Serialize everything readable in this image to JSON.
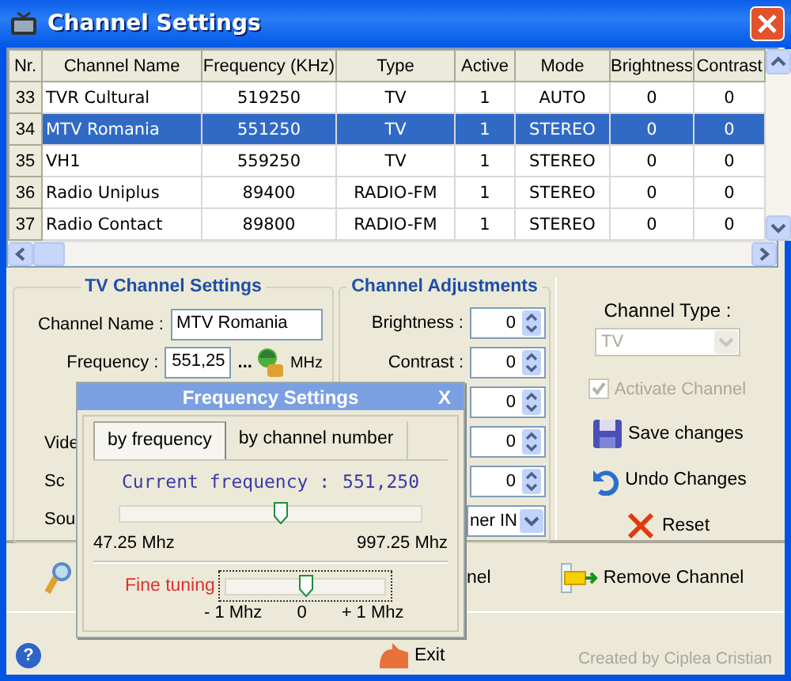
{
  "window": {
    "title": "Channel Settings"
  },
  "table": {
    "columns": [
      "Nr.",
      "Channel Name",
      "Frequency (KHz)",
      "Type",
      "Active",
      "Mode",
      "Brightness",
      "Contrast"
    ],
    "rows": [
      {
        "selected": false,
        "cells": [
          "33",
          "TVR Cultural",
          "519250",
          "TV",
          "1",
          "AUTO",
          "0",
          "0"
        ]
      },
      {
        "selected": true,
        "cells": [
          "34",
          "MTV Romania",
          "551250",
          "TV",
          "1",
          "STEREO",
          "0",
          "0"
        ]
      },
      {
        "selected": false,
        "cells": [
          "35",
          "VH1",
          "559250",
          "TV",
          "1",
          "STEREO",
          "0",
          "0"
        ]
      },
      {
        "selected": false,
        "cells": [
          "36",
          "Radio Uniplus",
          "89400",
          "RADIO-FM",
          "1",
          "STEREO",
          "0",
          "0"
        ]
      },
      {
        "selected": false,
        "cells": [
          "37",
          "Radio Contact",
          "89800",
          "RADIO-FM",
          "1",
          "STEREO",
          "0",
          "0"
        ]
      }
    ]
  },
  "tv_channel_settings": {
    "title": "TV Channel Settings",
    "name_label": "Channel Name :",
    "name_value": "MTV Romania",
    "frequency_label": "Frequency :",
    "frequency_value": "551,25",
    "more": "...",
    "unit": "MHz",
    "covered_labels": [
      "Vide",
      "Sc",
      "Sou"
    ]
  },
  "channel_adjustments": {
    "title": "Channel Adjustments",
    "rows": [
      {
        "kind": "spin",
        "label": "Brightness :",
        "value": "0"
      },
      {
        "kind": "spin",
        "label": "Contrast :",
        "value": "0"
      },
      {
        "kind": "spin",
        "value": "0"
      },
      {
        "kind": "spin",
        "value": "0"
      },
      {
        "kind": "spin",
        "value": "0"
      },
      {
        "kind": "dropdown",
        "value": "ner IN"
      }
    ]
  },
  "channel_panel": {
    "type_label": "Channel Type :",
    "type_value": "TV",
    "type_disabled": true,
    "activate_label": "Activate Channel",
    "activate_checked": true,
    "activate_disabled": true,
    "buttons": [
      {
        "kind": "save",
        "label": "Save changes"
      },
      {
        "kind": "undo",
        "label": "Undo Changes"
      },
      {
        "kind": "reset",
        "label": "Reset"
      }
    ]
  },
  "bottom_bar": {
    "buttons": [
      {
        "kind": "add",
        "label": "nel"
      },
      {
        "kind": "remove",
        "label": "Remove Channel"
      }
    ]
  },
  "footer": {
    "help": "?",
    "exit": "Exit",
    "credit": "Created by Ciplea Cristian"
  },
  "frequency_dialog": {
    "title": "Frequency Settings",
    "close": "X",
    "tabs": [
      {
        "label": "by frequency",
        "selected": true
      },
      {
        "label": "by channel number",
        "selected": false
      }
    ],
    "current_label": "Current frequency :",
    "current_value": "551,250",
    "slider": {
      "level": 0.53,
      "min_label": "47.25 Mhz",
      "max_label": "997.25 Mhz"
    },
    "fine_tuning": {
      "label": "Fine tuning",
      "level": 0.5,
      "ticks": [
        "- 1 Mhz",
        "0",
        "+ 1 Mhz"
      ]
    }
  }
}
